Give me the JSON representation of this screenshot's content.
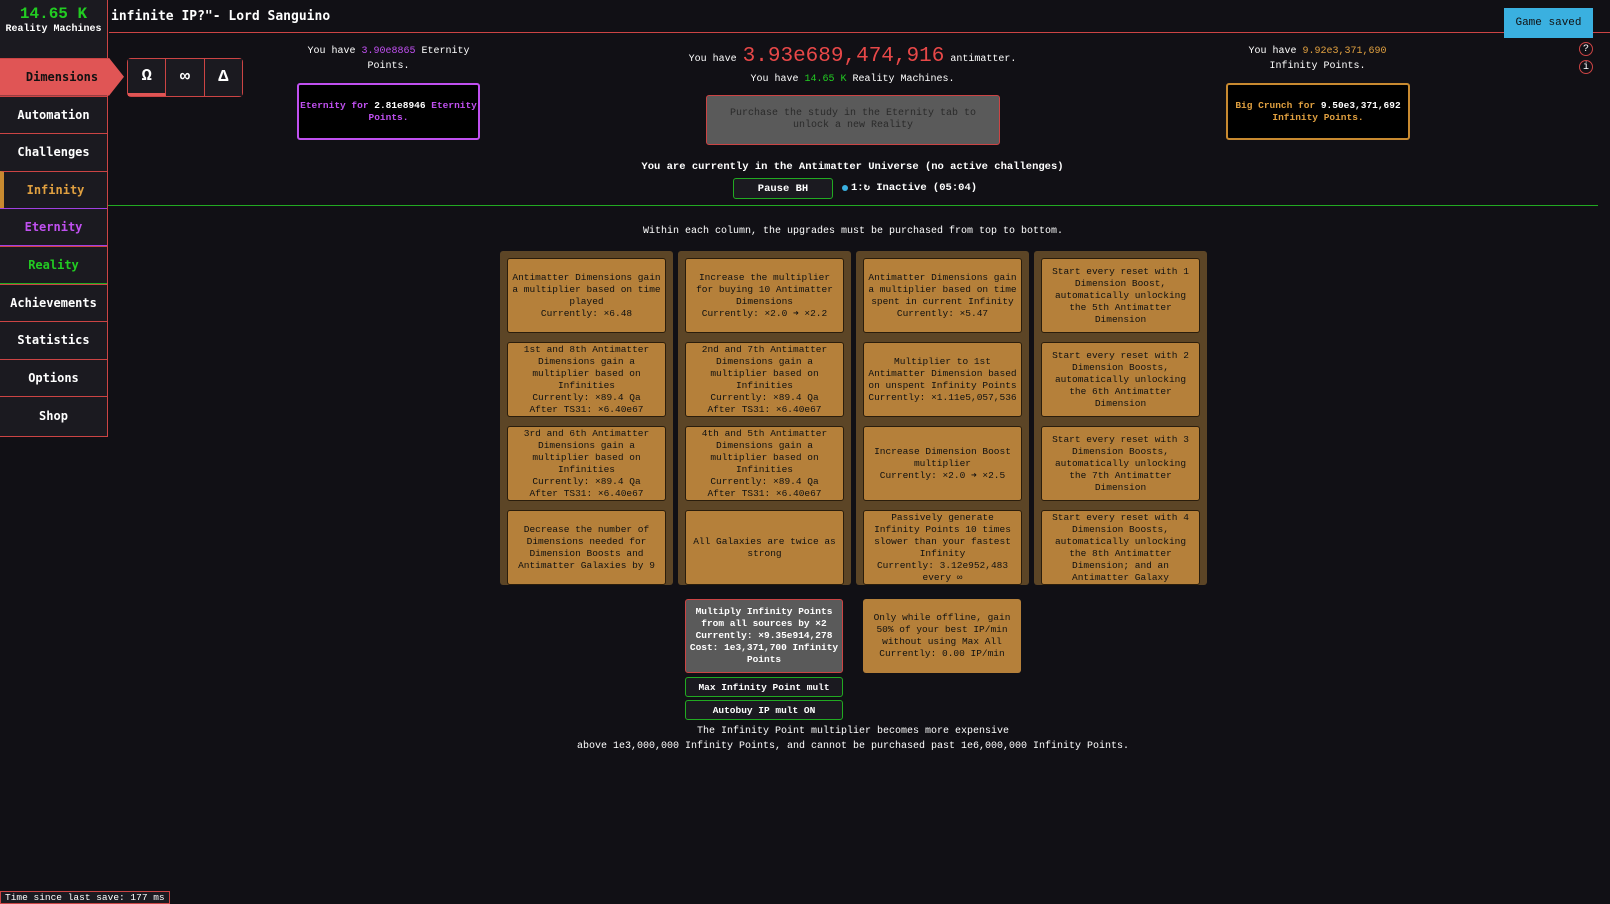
{
  "sidebar": {
    "rm_value": "14.65 K",
    "rm_label": "Reality Machines",
    "items": [
      {
        "label": "Dimensions"
      },
      {
        "label": "Automation"
      },
      {
        "label": "Challenges"
      },
      {
        "label": "Infinity"
      },
      {
        "label": "Eternity"
      },
      {
        "label": "Reality"
      },
      {
        "label": "Achievements"
      },
      {
        "label": "Statistics"
      },
      {
        "label": "Options"
      },
      {
        "label": "Shop"
      }
    ]
  },
  "title": "infinite IP?\"- Lord Sanguino",
  "game_saved": "Game saved",
  "subtabs": [
    "Ω",
    "∞",
    "Δ"
  ],
  "eternity": {
    "pre": "You have ",
    "value": "3.90e8865",
    "post": " Eternity Points.",
    "btn_pre": "Eternity for ",
    "btn_value": "2.81e8946",
    "btn_post": " Eternity Points."
  },
  "antimatter": {
    "pre": "You have ",
    "value": "3.93e689,474,916",
    "post": " antimatter."
  },
  "reality": {
    "pre": "You have ",
    "value": "14.65 K",
    "post": " Reality Machines.",
    "btn": "Purchase the study in the Eternity tab to unlock a new Reality"
  },
  "infinity": {
    "pre": "You have ",
    "value": "9.92e3,371,690",
    "post": " Infinity Points.",
    "btn_pre": "Big Crunch for ",
    "btn_value": "9.50e3,371,692",
    "btn_post": " Infinity Points."
  },
  "status": "You are currently in the Antimatter Universe (no active challenges)",
  "pause_bh": "Pause BH",
  "bh_status": "1:↻ Inactive (05:04)",
  "instructions": "Within each column, the upgrades must be purchased from top to bottom.",
  "colors": {
    "antimatter": "#e84848",
    "reality": "#22cc22",
    "eternity": "#c050f0",
    "infinity": "#e0a040",
    "card": "#b5803a"
  },
  "columns": [
    [
      [
        "Antimatter Dimensions gain a multiplier based on time played",
        "Currently: ×6.48"
      ],
      [
        "1st and 8th Antimatter Dimensions gain a multiplier based on Infinities",
        "Currently: ×89.4 Qa",
        "After TS31: ×6.40e67"
      ],
      [
        "3rd and 6th Antimatter Dimensions gain a multiplier based on Infinities",
        "Currently: ×89.4 Qa",
        "After TS31: ×6.40e67"
      ],
      [
        "Decrease the number of Dimensions needed for Dimension Boosts and Antimatter Galaxies by 9"
      ]
    ],
    [
      [
        "Increase the multiplier for buying 10 Antimatter Dimensions",
        "Currently: ×2.0 ➜ ×2.2"
      ],
      [
        "2nd and 7th Antimatter Dimensions gain a multiplier based on Infinities",
        "Currently: ×89.4 Qa",
        "After TS31: ×6.40e67"
      ],
      [
        "4th and 5th Antimatter Dimensions gain a multiplier based on Infinities",
        "Currently: ×89.4 Qa",
        "After TS31: ×6.40e67"
      ],
      [
        "All Galaxies are twice as strong"
      ]
    ],
    [
      [
        "Antimatter Dimensions gain a multiplier based on time spent in current Infinity",
        "Currently: ×5.47"
      ],
      [
        "Multiplier to 1st Antimatter Dimension based on unspent Infinity Points",
        "Currently: ×1.11e5,057,536"
      ],
      [
        "Increase Dimension Boost multiplier",
        "Currently: ×2.0 ➜ ×2.5"
      ],
      [
        "Passively generate Infinity Points 10 times slower than your fastest Infinity",
        "Currently: 3.12e952,483 every ∞"
      ]
    ],
    [
      [
        "Start every reset with 1 Dimension Boost, automatically unlocking the 5th Antimatter Dimension"
      ],
      [
        "Start every reset with 2 Dimension Boosts, automatically unlocking the 6th Antimatter Dimension"
      ],
      [
        "Start every reset with 3 Dimension Boosts, automatically unlocking the 7th Antimatter Dimension"
      ],
      [
        "Start every reset with 4 Dimension Boosts, automatically unlocking the 8th Antimatter Dimension; and an Antimatter Galaxy"
      ]
    ]
  ],
  "ip_mult": [
    "Multiply Infinity Points from all sources by ×2",
    "Currently: ×9.35e914,278",
    "Cost: 1e3,371,700 Infinity Points"
  ],
  "offline": [
    "Only while offline, gain 50% of your best IP/min without using Max All",
    "Currently: 0.00 IP/min"
  ],
  "max_ip": "Max Infinity Point mult",
  "autobuy": "Autobuy IP mult ON",
  "note1": "The Infinity Point multiplier becomes more expensive",
  "note2": "above 1e3,000,000 Infinity Points, and cannot be purchased past 1e6,000,000 Infinity Points.",
  "last_save": "Time since last save: 177 ms"
}
